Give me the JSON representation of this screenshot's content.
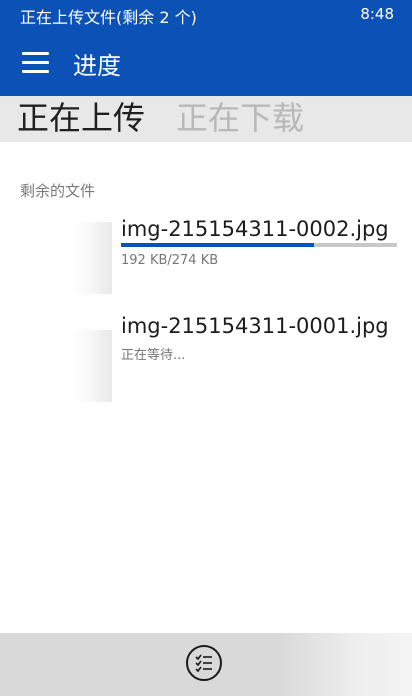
{
  "status_bar": {
    "title": "正在上传文件(剩余 2 个)",
    "time": "8:48"
  },
  "app_bar": {
    "title": "进度",
    "menu_icon": "hamburger-menu-icon"
  },
  "pivot": {
    "active_tab": "正在上传",
    "inactive_tab": "正在下载"
  },
  "section": {
    "label": "剩余的文件"
  },
  "files": [
    {
      "name": "img-215154311-0002.jpg",
      "status": "192 KB/274 KB",
      "progress": 0.7
    },
    {
      "name": "img-215154311-0001.jpg",
      "status": "正在等待..."
    }
  ],
  "bottom_bar": {
    "icon": "list-checklist-icon"
  },
  "colors": {
    "accent": "#0c51b5",
    "pivot_background": "#e8e8e8",
    "bottom_bar": "#d9d9d9"
  }
}
